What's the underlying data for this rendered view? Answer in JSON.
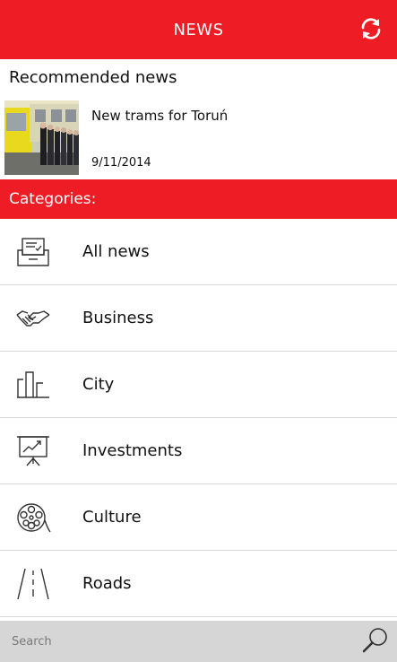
{
  "header": {
    "title": "NEWS",
    "refresh_icon": "refresh-icon",
    "color": "#ee1c25"
  },
  "recommended": {
    "section_title": "Recommended news",
    "headline": "New trams for Toruń",
    "date": "9/11/2014"
  },
  "categories": {
    "title": "Categories:",
    "items": [
      {
        "label": "All news",
        "icon": "inbox-icon"
      },
      {
        "label": "Business",
        "icon": "handshake-icon"
      },
      {
        "label": "City",
        "icon": "city-icon"
      },
      {
        "label": "Investments",
        "icon": "chart-board-icon"
      },
      {
        "label": "Culture",
        "icon": "film-reel-icon"
      },
      {
        "label": "Roads",
        "icon": "road-icon"
      }
    ]
  },
  "search": {
    "placeholder": "Search",
    "icon": "search-icon"
  }
}
